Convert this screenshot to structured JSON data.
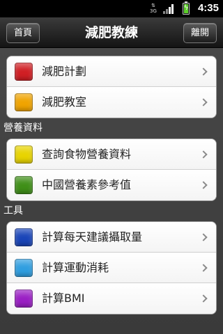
{
  "status_bar": {
    "network": "3G",
    "time": "4:35",
    "battery_level": 0.85
  },
  "title_bar": {
    "back_label": "首頁",
    "title": "減肥教練",
    "exit_label": "離開"
  },
  "groups": [
    {
      "header": "",
      "items": [
        {
          "label": "減肥計劃",
          "color": "#d01f24"
        },
        {
          "label": "減肥教室",
          "color": "#f0a400"
        }
      ]
    },
    {
      "header": "營養資料",
      "items": [
        {
          "label": "查詢食物營養資料",
          "color": "#e8d400"
        },
        {
          "label": "中國營養素參考值",
          "color": "#3f8f18"
        }
      ]
    },
    {
      "header": "工具",
      "items": [
        {
          "label": "計算每天建議攝取量",
          "color": "#1a45b8"
        },
        {
          "label": "計算運動消耗",
          "color": "#2f9ee0"
        },
        {
          "label": "計算BMI",
          "color": "#9a1fc4"
        }
      ]
    }
  ]
}
